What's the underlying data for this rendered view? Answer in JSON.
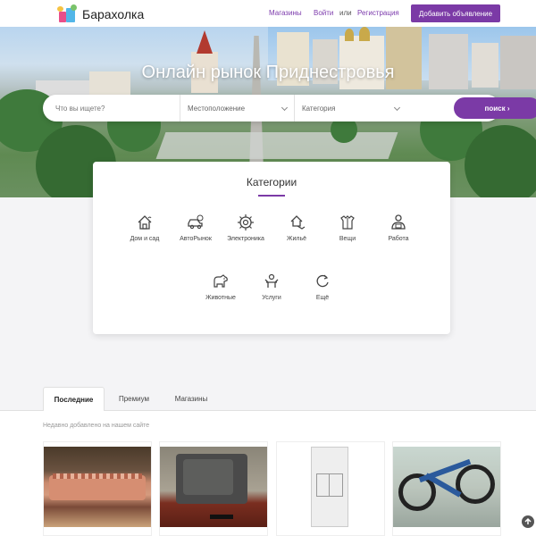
{
  "header": {
    "logo_text": "Барахолка",
    "nav": {
      "stores": "Магазины",
      "login": "Войти",
      "or": "или",
      "register": "Регистрация"
    },
    "add_button": "Добавить объявление"
  },
  "hero": {
    "title": "Онлайн рынок Приднестровья"
  },
  "search": {
    "placeholder": "Что вы ищете?",
    "location": "Местоположение",
    "category": "Категория",
    "button": "поиск ›"
  },
  "categories": {
    "title": "Категории",
    "items": [
      {
        "label": "Дом и сад",
        "icon": "house-garden-icon"
      },
      {
        "label": "АвтоРынок",
        "icon": "car-icon"
      },
      {
        "label": "Электроника",
        "icon": "gear-chip-icon"
      },
      {
        "label": "Жильё",
        "icon": "house-hand-icon"
      },
      {
        "label": "Вещи",
        "icon": "clothes-icon"
      },
      {
        "label": "Работа",
        "icon": "worker-icon"
      },
      {
        "label": "Животные",
        "icon": "dog-icon"
      },
      {
        "label": "Услуги",
        "icon": "services-icon"
      },
      {
        "label": "Ещё",
        "icon": "refresh-icon"
      }
    ]
  },
  "tabs": [
    {
      "label": "Последние",
      "active": true
    },
    {
      "label": "Премиум",
      "active": false
    },
    {
      "label": "Магазины",
      "active": false
    }
  ],
  "recent_caption": "Недавно добавлено на нашем сайте",
  "listings": [
    {
      "image": "sofa-photo"
    },
    {
      "image": "tv-photo"
    },
    {
      "image": "floor-plan-photo"
    },
    {
      "image": "bicycle-photo"
    }
  ],
  "colors": {
    "accent": "#7b3aa6"
  }
}
